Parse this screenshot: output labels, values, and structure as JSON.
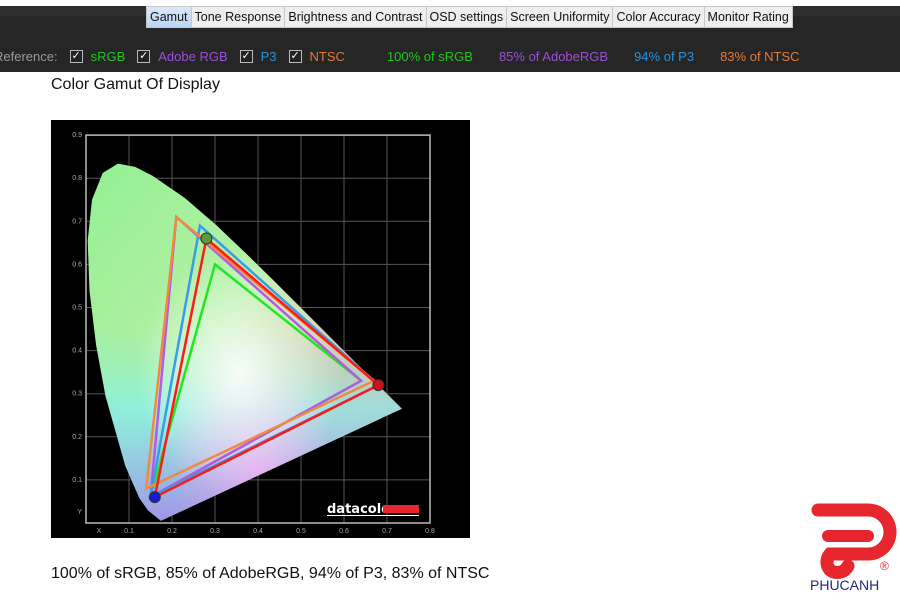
{
  "tabs": [
    {
      "label": "Gamut",
      "active": true
    },
    {
      "label": "Tone Response"
    },
    {
      "label": "Brightness and Contrast"
    },
    {
      "label": "OSD settings"
    },
    {
      "label": "Screen Uniformity"
    },
    {
      "label": "Color Accuracy"
    },
    {
      "label": "Monitor Rating"
    }
  ],
  "reference": {
    "label": "Reference:",
    "items": [
      {
        "label": "sRGB",
        "checked": true,
        "color": "#22c422"
      },
      {
        "label": "Adobe RGB",
        "checked": true,
        "color": "#9b4fd6"
      },
      {
        "label": "P3",
        "checked": true,
        "color": "#2f8fd8"
      },
      {
        "label": "NTSC",
        "checked": true,
        "color": "#e07a3a"
      }
    ],
    "coverage": [
      {
        "text": "100% of sRGB",
        "color": "#22c422"
      },
      {
        "text": "85% of AdobeRGB",
        "color": "#9b4fd6"
      },
      {
        "text": "94% of P3",
        "color": "#2f8fd8"
      },
      {
        "text": "83% of NTSC",
        "color": "#e07a3a"
      }
    ]
  },
  "page_title": "Color Gamut Of Display",
  "caption": "100% of sRGB, 85% of AdobeRGB, 94% of P3, 83% of NTSC",
  "logo": {
    "text": "PHUCANH",
    "registered": "®",
    "color": "#e8262d",
    "text_color": "#1f2a78"
  },
  "chart_data": {
    "type": "scatter",
    "title": "",
    "xlabel": "X",
    "ylabel": "Y",
    "xlim": [
      0,
      0.8
    ],
    "ylim": [
      0,
      0.9
    ],
    "x_ticks": [
      "0.1",
      "0.2",
      "0.3",
      "0.4",
      "0.5",
      "0.6",
      "0.7",
      "0.8"
    ],
    "y_ticks": [
      "0.1",
      "0.2",
      "0.3",
      "0.4",
      "0.5",
      "0.6",
      "0.7",
      "0.8",
      "0.9"
    ],
    "grid": true,
    "watermark": "datacolor",
    "series": [
      {
        "key": "srgb",
        "color": "#22e622",
        "points": [
          [
            0.64,
            0.33
          ],
          [
            0.3,
            0.6
          ],
          [
            0.15,
            0.06
          ]
        ]
      },
      {
        "key": "adobergb",
        "color": "#b25be6",
        "points": [
          [
            0.64,
            0.33
          ],
          [
            0.21,
            0.71
          ],
          [
            0.15,
            0.06
          ]
        ]
      },
      {
        "key": "p3",
        "color": "#3a9be6",
        "points": [
          [
            0.68,
            0.32
          ],
          [
            0.265,
            0.69
          ],
          [
            0.15,
            0.06
          ]
        ]
      },
      {
        "key": "ntsc",
        "color": "#f08a40",
        "points": [
          [
            0.67,
            0.33
          ],
          [
            0.21,
            0.71
          ],
          [
            0.14,
            0.08
          ]
        ]
      },
      {
        "key": "display",
        "color": "#ff1a1a",
        "points": [
          [
            0.68,
            0.32
          ],
          [
            0.28,
            0.66
          ],
          [
            0.16,
            0.06
          ]
        ]
      }
    ]
  }
}
